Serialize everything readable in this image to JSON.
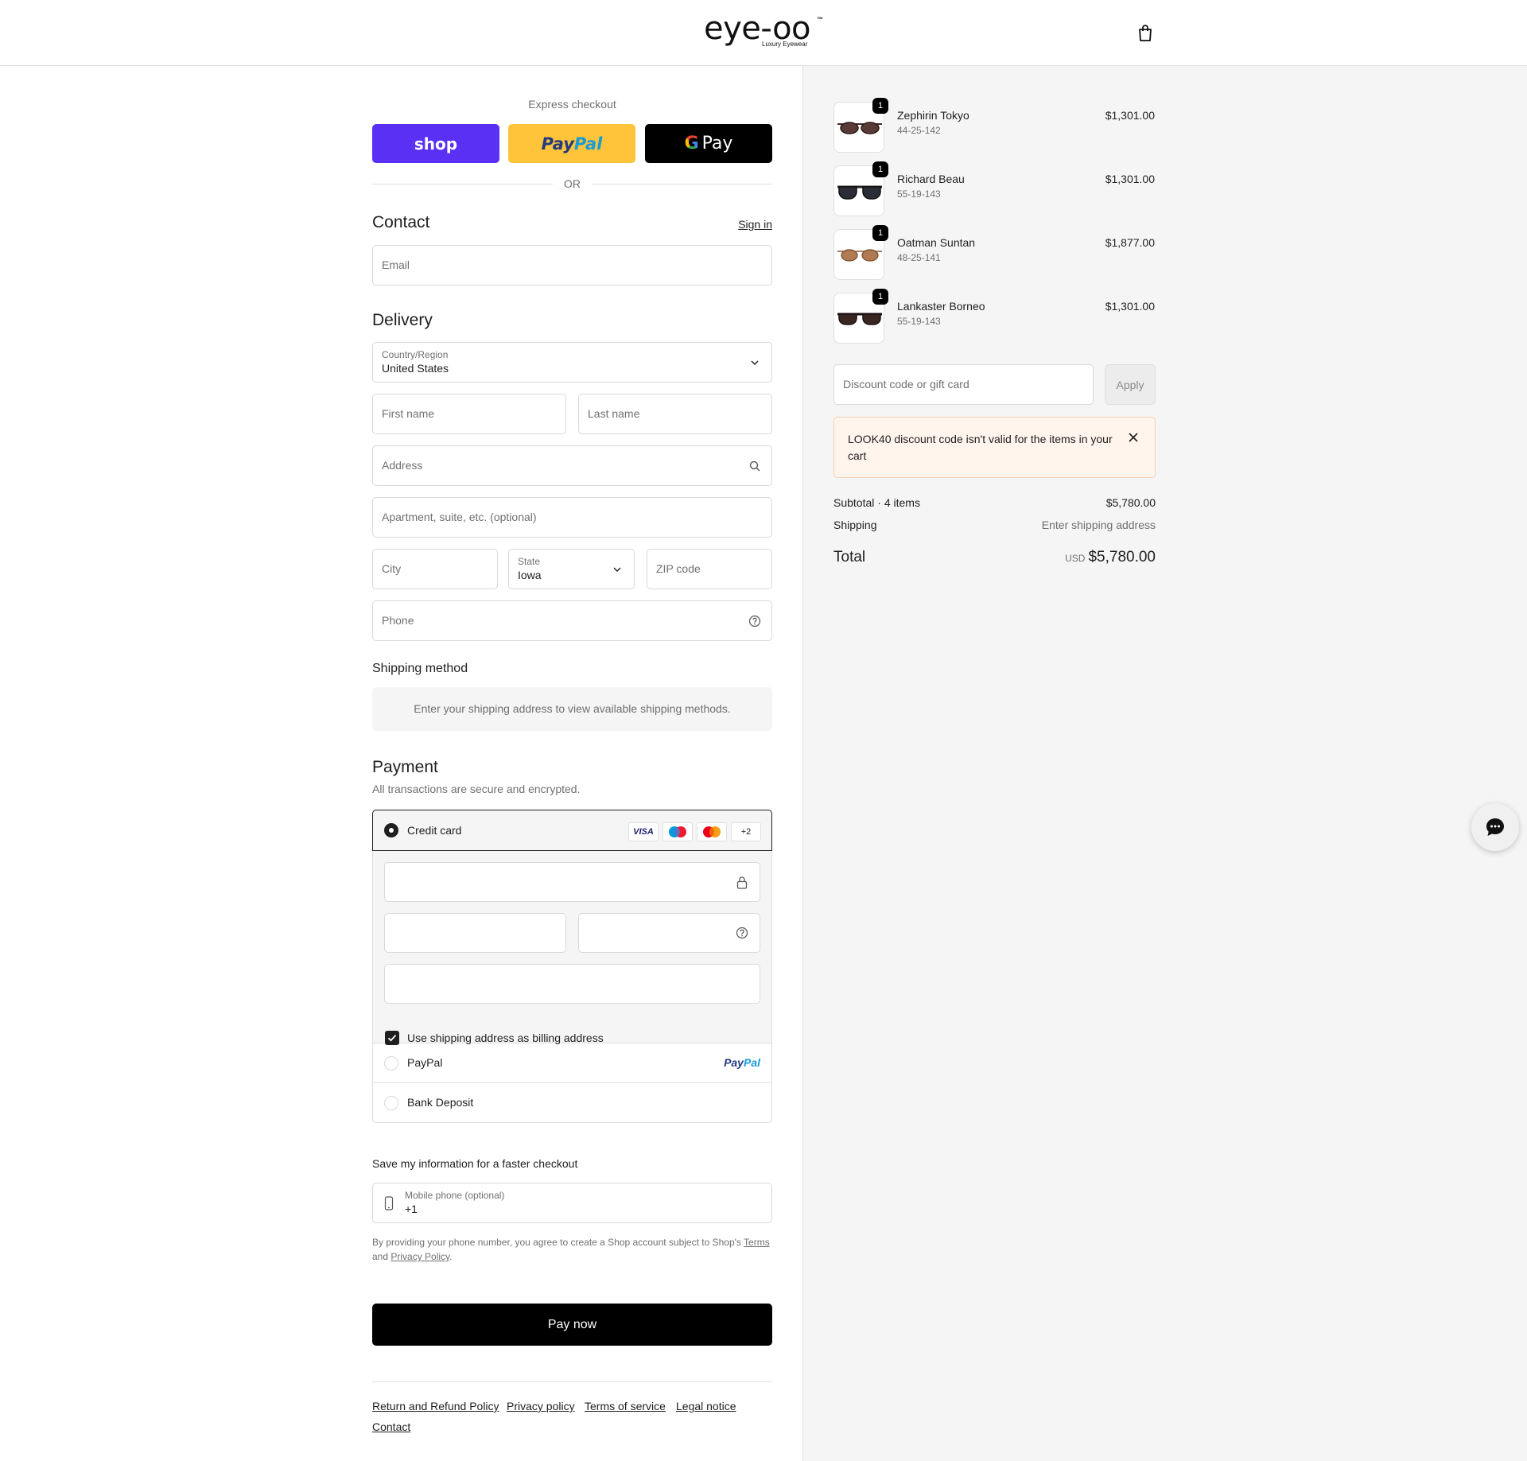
{
  "header": {
    "logo_text": "eye-oo",
    "logo_tm": "™",
    "logo_tagline": "Luxury Eyewear",
    "cart_icon": "shopping-bag-icon"
  },
  "express": {
    "label": "Express checkout",
    "shop_label": "shop",
    "paypal_label_a": "Pay",
    "paypal_label_b": "Pal",
    "gpay_g": "G",
    "gpay_label": "Pay",
    "or": "OR"
  },
  "contact": {
    "title": "Contact",
    "sign_in": "Sign in",
    "email_placeholder": "Email"
  },
  "delivery": {
    "title": "Delivery",
    "country_label": "Country/Region",
    "country_value": "United States",
    "first_name": "First name",
    "last_name": "Last name",
    "address": "Address",
    "apartment": "Apartment, suite, etc. (optional)",
    "city": "City",
    "state_label": "State",
    "state_value": "Iowa",
    "zip": "ZIP code",
    "phone": "Phone"
  },
  "shipping_method": {
    "title": "Shipping method",
    "note": "Enter your shipping address to view available shipping methods."
  },
  "payment": {
    "title": "Payment",
    "subtitle": "All transactions are secure and encrypted.",
    "credit_card": "Credit card",
    "card_badges": [
      "VISA",
      "+2"
    ],
    "billing_checkbox": "Use shipping address as billing address",
    "paypal": "PayPal",
    "paypal_logo_a": "Pay",
    "paypal_logo_b": "Pal",
    "bank_deposit": "Bank Deposit"
  },
  "save_info": {
    "title": "Save my information for a faster checkout",
    "mobile_label": "Mobile phone (optional)",
    "mobile_value": "+1",
    "legal_prefix": "By providing your phone number, you agree to create a Shop account subject to Shop's",
    "terms": "Terms",
    "and": "and",
    "privacy": "Privacy Policy",
    "period": "."
  },
  "pay_now": "Pay now",
  "footer": {
    "links": [
      "Return and Refund Policy",
      "Privacy policy",
      "Terms of service",
      "Legal notice",
      "Contact"
    ]
  },
  "cart": {
    "items": [
      {
        "name": "Zephirin Tokyo",
        "sku": "44-25-142",
        "price": "$1,301.00",
        "qty": "1",
        "lens_color": "#5a3a36"
      },
      {
        "name": "Richard Beau",
        "sku": "55-19-143",
        "price": "$1,301.00",
        "qty": "1",
        "lens_color": "#2a2d36"
      },
      {
        "name": "Oatman Suntan",
        "sku": "48-25-141",
        "price": "$1,877.00",
        "qty": "1",
        "lens_color": "#b07a52"
      },
      {
        "name": "Lankaster Borneo",
        "sku": "55-19-143",
        "price": "$1,301.00",
        "qty": "1",
        "lens_color": "#3a2724"
      }
    ],
    "discount_placeholder": "Discount code or gift card",
    "apply": "Apply",
    "alert": "LOOK40 discount code isn't valid for the items in your cart",
    "subtotal_label": "Subtotal · 4 items",
    "subtotal_value": "$5,780.00",
    "shipping_label": "Shipping",
    "shipping_value": "Enter shipping address",
    "total_label": "Total",
    "currency": "USD",
    "total_value": "$5,780.00"
  },
  "chat_icon": "chat-bubble-icon"
}
